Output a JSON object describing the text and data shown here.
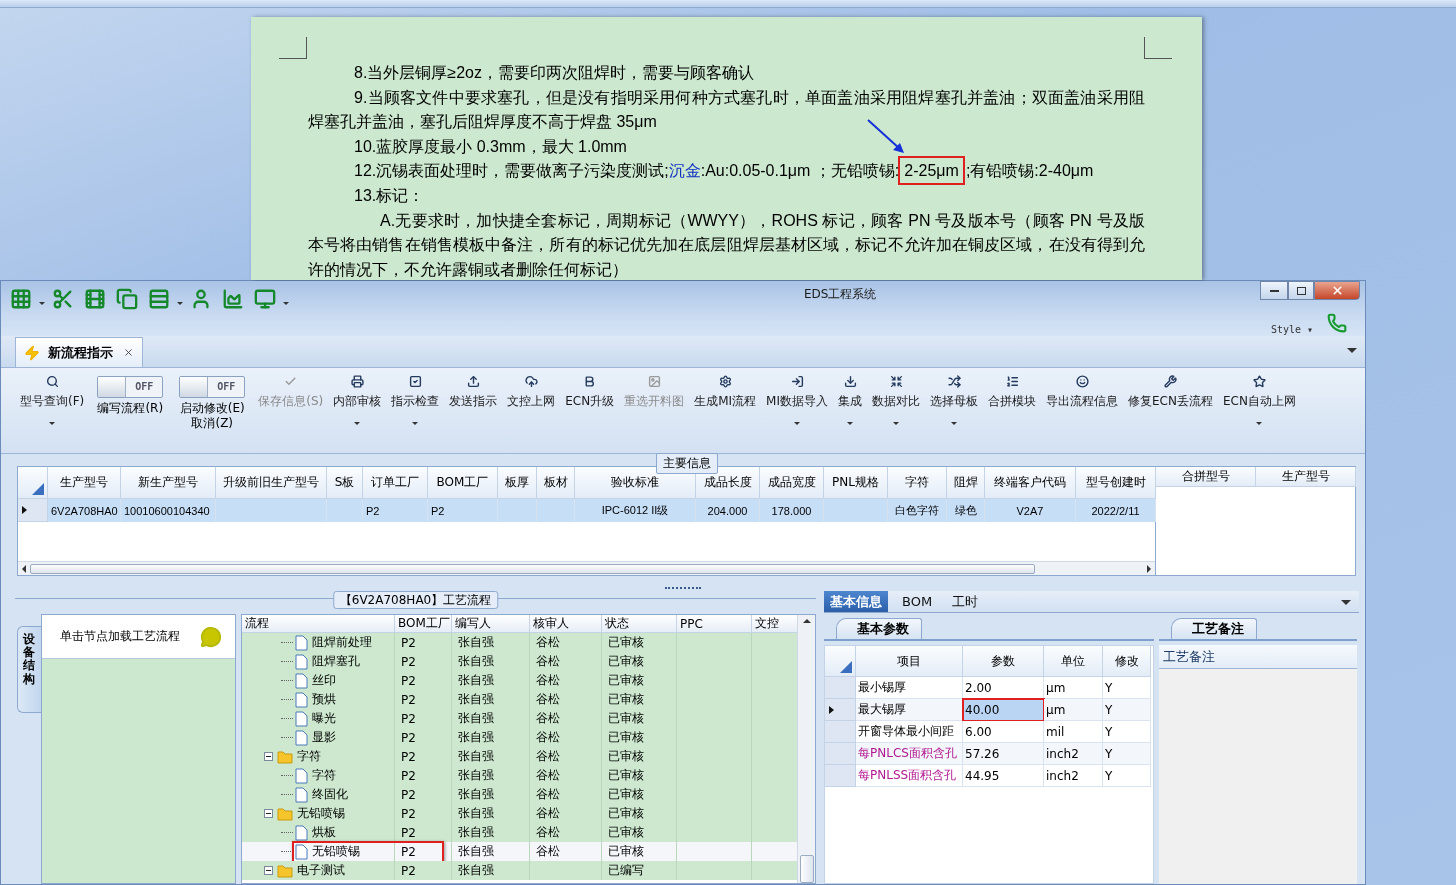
{
  "document": {
    "paragraphs": [
      {
        "kind": "item",
        "segments": [
          {
            "text": "8.当外层铜厚≥2oz，需要印两次阻焊时，需要与顾客确认"
          }
        ]
      },
      {
        "kind": "item",
        "segments": [
          {
            "text": "9.当顾客文件中要求塞孔，但是没有指明采用何种方式塞孔时，单面盖油采用阻焊塞孔并盖油；双面盖油采用阻焊塞孔并盖油，塞孔后阻焊厚度不高于焊盘 35μm"
          }
        ]
      },
      {
        "kind": "item",
        "segments": [
          {
            "text": "10.蓝胶厚度最小 0.3mm，最大 1.0mm"
          }
        ]
      },
      {
        "kind": "item",
        "segments": [
          {
            "text": "12.沉锡表面处理时，需要做离子污染度测试;"
          },
          {
            "text": "沉金",
            "kind": "field"
          },
          {
            "text": ":Au:0.05-0.1μm ；无铅喷锡:"
          },
          {
            "text": "2-25μm",
            "kind": "highlight"
          },
          {
            "text": ";有铅喷锡:2-40μm"
          }
        ]
      },
      {
        "kind": "item",
        "segments": [
          {
            "text": "13.标记："
          }
        ]
      },
      {
        "kind": "sub_item",
        "segments": [
          {
            "text": "A.无要求时，加快捷全套标记，周期标记（WWYY），ROHS 标记，顾客 PN 号及版本号（顾客 PN 号及版本号将由销售在销售模板中备注，所有的标记优先加在底层阻焊层基材区域，标记不允许加在铜皮区域，在没有得到允许的情况下，不允许露铜或者删除任何标记）"
          }
        ]
      }
    ]
  },
  "window": {
    "title": "EDS工程系统",
    "style_label": "Style ▾",
    "tab": {
      "label": "新流程指示",
      "selected": true
    }
  },
  "ribbon": [
    {
      "kind": "button",
      "label": "型号查询(F)",
      "disabled": false,
      "has_menu": true
    },
    {
      "kind": "toggle",
      "on": false,
      "state_text": "OFF",
      "label": "编写流程(R)"
    },
    {
      "kind": "toggle",
      "on": false,
      "state_text": "OFF",
      "label": "启动修改(E)",
      "sub_label": "取消(Z)"
    },
    {
      "kind": "button",
      "label": "保存信息(S)",
      "disabled": true,
      "has_menu": false
    },
    {
      "kind": "button",
      "label": "内部审核",
      "disabled": false,
      "has_menu": true
    },
    {
      "kind": "button",
      "label": "指示检查",
      "disabled": false,
      "has_menu": true
    },
    {
      "kind": "button",
      "label": "发送指示",
      "disabled": false,
      "has_menu": false
    },
    {
      "kind": "button",
      "label": "文控上网",
      "disabled": false,
      "has_menu": false
    },
    {
      "kind": "button",
      "label": "ECN升级",
      "disabled": false,
      "has_menu": false
    },
    {
      "kind": "button",
      "label": "重选开料图",
      "disabled": true,
      "has_menu": false
    },
    {
      "kind": "button",
      "label": "生成MI流程",
      "disabled": false,
      "has_menu": false
    },
    {
      "kind": "button",
      "label": "MI数据导入",
      "disabled": false,
      "has_menu": true
    },
    {
      "kind": "button",
      "label": "集成",
      "disabled": false,
      "has_menu": true
    },
    {
      "kind": "button",
      "label": "数据对比",
      "disabled": false,
      "has_menu": true
    },
    {
      "kind": "button",
      "label": "选择母板",
      "disabled": false,
      "has_menu": true
    },
    {
      "kind": "button",
      "label": "合拼模块",
      "disabled": false,
      "has_menu": false
    },
    {
      "kind": "button",
      "label": "导出流程信息",
      "disabled": false,
      "has_menu": false
    },
    {
      "kind": "button",
      "label": "修复ECN丢流程",
      "disabled": false,
      "has_menu": false
    },
    {
      "kind": "button",
      "label": "ECN自动上网",
      "disabled": false,
      "has_menu": true
    }
  ],
  "main_info": {
    "label": "主要信息",
    "columns": [
      "生产型号",
      "新生产型号",
      "升级前旧生产型号",
      "S板",
      "订单工厂",
      "BOM工厂",
      "板厚",
      "板材",
      "验收标准",
      "成品长度",
      "成品宽度",
      "PNL规格",
      "字符",
      "阻焊",
      "终端客户代码",
      "型号创建时"
    ],
    "rows": [
      {
        "selected": true,
        "cells": [
          "6V2A708HA0",
          "10010600104340",
          null,
          null,
          "P2",
          "P2",
          null,
          null,
          "IPC-6012 II级",
          "204.000",
          "178.000",
          null,
          "白色字符",
          "绿色",
          "V2A7",
          "2022/2/11"
        ]
      }
    ],
    "side_columns": [
      "合拼型号",
      "生产型号"
    ]
  },
  "equipment_panel": {
    "tab": "设备结构",
    "item": "单击节点加载工艺流程"
  },
  "process_tree": {
    "title": "【6V2A708HA0】工艺流程",
    "columns": [
      "流程",
      "BOM工厂",
      "编写人",
      "核审人",
      "状态",
      "PPC",
      "文控"
    ],
    "continued_rows": [
      {
        "name": "阻焊前处理",
        "bom_factory": "P2",
        "author": "张自强",
        "reviewer": "谷松",
        "status": "已审核",
        "selected": false,
        "highlighted": false
      },
      {
        "name": "阻焊塞孔",
        "bom_factory": "P2",
        "author": "张自强",
        "reviewer": "谷松",
        "status": "已审核",
        "selected": false,
        "highlighted": false
      },
      {
        "name": "丝印",
        "bom_factory": "P2",
        "author": "张自强",
        "reviewer": "谷松",
        "status": "已审核",
        "selected": false,
        "highlighted": false
      },
      {
        "name": "预烘",
        "bom_factory": "P2",
        "author": "张自强",
        "reviewer": "谷松",
        "status": "已审核",
        "selected": false,
        "highlighted": false
      },
      {
        "name": "曝光",
        "bom_factory": "P2",
        "author": "张自强",
        "reviewer": "谷松",
        "status": "已审核",
        "selected": false,
        "highlighted": false
      },
      {
        "name": "显影",
        "bom_factory": "P2",
        "author": "张自强",
        "reviewer": "谷松",
        "status": "已审核",
        "selected": false,
        "highlighted": false
      }
    ],
    "nodes": [
      {
        "name": "字符",
        "bom_factory": "P2",
        "author": "张自强",
        "reviewer": "谷松",
        "status": "已审核",
        "selected": false,
        "highlighted": false,
        "expanded": true,
        "children": [
          {
            "name": "字符",
            "bom_factory": "P2",
            "author": "张自强",
            "reviewer": "谷松",
            "status": "已审核",
            "selected": false,
            "highlighted": false
          },
          {
            "name": "终固化",
            "bom_factory": "P2",
            "author": "张自强",
            "reviewer": "谷松",
            "status": "已审核",
            "selected": false,
            "highlighted": false
          }
        ]
      },
      {
        "name": "无铅喷锡",
        "bom_factory": "P2",
        "author": "张自强",
        "reviewer": "谷松",
        "status": "已审核",
        "selected": false,
        "highlighted": false,
        "expanded": true,
        "children": [
          {
            "name": "烘板",
            "bom_factory": "P2",
            "author": "张自强",
            "reviewer": "谷松",
            "status": "已审核",
            "selected": false,
            "highlighted": false
          },
          {
            "name": "无铅喷锡",
            "bom_factory": "P2",
            "author": "张自强",
            "reviewer": "谷松",
            "status": "已审核",
            "selected": true,
            "highlighted": true
          }
        ]
      },
      {
        "name": "电子测试",
        "bom_factory": "P2",
        "author": "张自强",
        "status": "已编写",
        "selected": false,
        "highlighted": false,
        "expanded": true
      }
    ]
  },
  "detail_panel": {
    "tabs": [
      {
        "label": "基本信息",
        "selected": true
      },
      {
        "label": "BOM",
        "selected": false
      },
      {
        "label": "工时",
        "selected": false
      }
    ],
    "param_tab": "基本参数",
    "param_columns": [
      "项目",
      "参数",
      "单位",
      "修改"
    ],
    "params": [
      {
        "item": "最小锡厚",
        "value": "2.00",
        "unit": "μm",
        "modifiable": "Y",
        "current": false,
        "highlighted": false
      },
      {
        "item": "最大锡厚",
        "value": "40.00",
        "unit": "μm",
        "modifiable": "Y",
        "current": true,
        "highlighted": true
      },
      {
        "item": "开窗导体最小间距",
        "value": "6.00",
        "unit": "mil",
        "modifiable": "Y",
        "current": false,
        "highlighted": false
      },
      {
        "item": "每PNLCS面积含孔",
        "value": "57.26",
        "unit": "inch2",
        "modifiable": "Y",
        "color": "#b01890",
        "current": false,
        "highlighted": false
      },
      {
        "item": "每PNLSS面积含孔",
        "value": "44.95",
        "unit": "inch2",
        "modifiable": "Y",
        "color": "#b01890",
        "current": false,
        "highlighted": false
      }
    ],
    "notes_tab": "工艺备注",
    "notes_header": "工艺备注"
  }
}
